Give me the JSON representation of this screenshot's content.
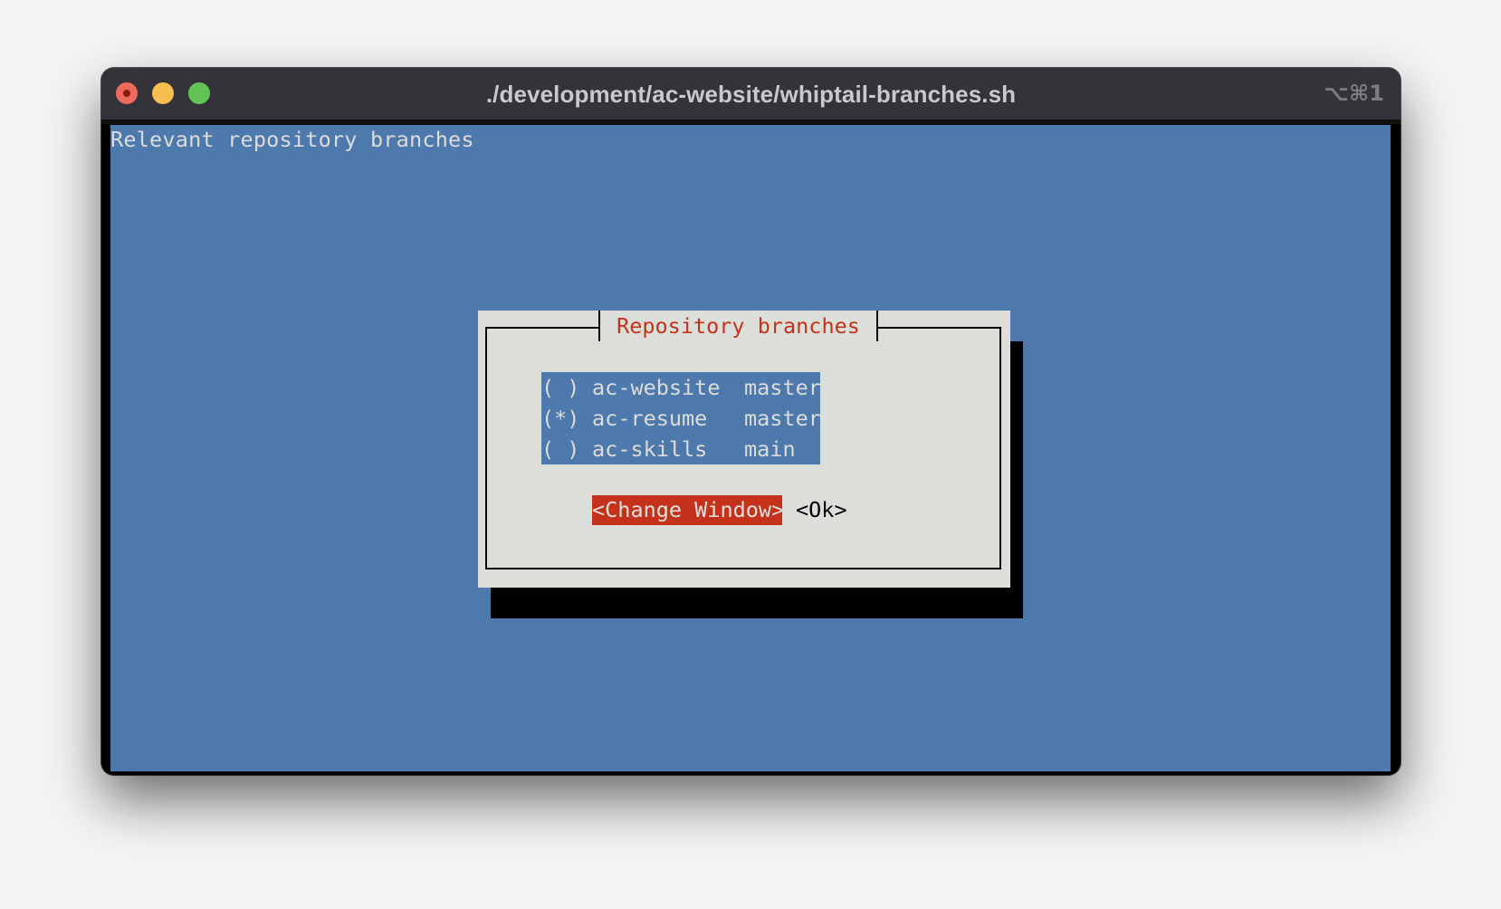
{
  "window": {
    "title": "./development/ac-website/whiptail-branches.sh",
    "shortcut": "⌥⌘1",
    "controls": {
      "close": "close-button",
      "minimize": "minimize-button",
      "maximize": "maximize-button"
    }
  },
  "terminal": {
    "backtitle": "Relevant repository branches",
    "background_color": "#4e79ad"
  },
  "dialog": {
    "title": "Repository branches",
    "items": [
      {
        "mark": "( )",
        "name": "ac-website",
        "branch": "master",
        "selected": false
      },
      {
        "mark": "(*)",
        "name": "ac-resume",
        "branch": "master",
        "selected": true
      },
      {
        "mark": "( )",
        "name": "ac-skills",
        "branch": "main",
        "selected": false
      }
    ],
    "buttons": {
      "change_window": "<Change Window>",
      "ok": "<Ok>"
    },
    "focused_button": "change_window",
    "accent_color": "#c4321c",
    "background_color": "#dcdeda"
  }
}
